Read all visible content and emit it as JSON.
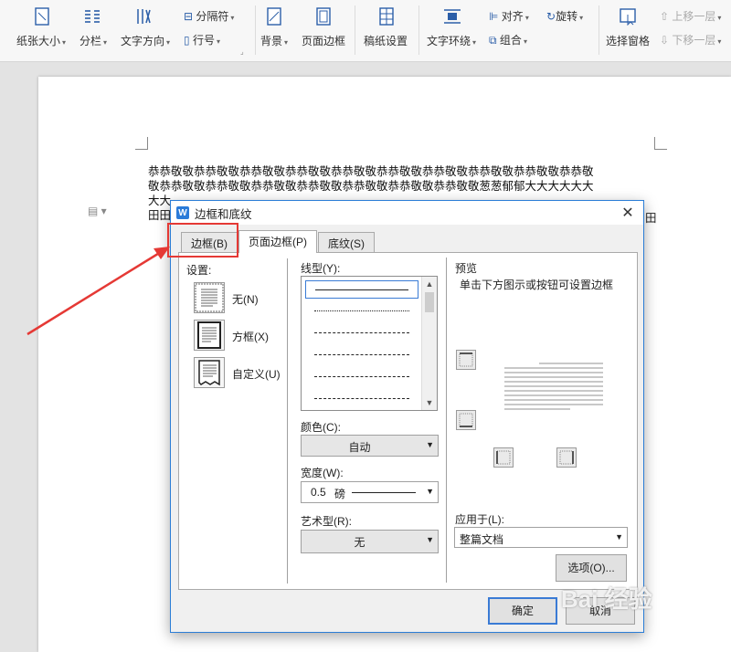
{
  "ribbon": {
    "paper_size": "纸张大小",
    "columns": "分栏",
    "text_direction": "文字方向",
    "separator": "分隔符",
    "line_number": "行号",
    "background": "背景",
    "page_border": "页面边框",
    "manuscript": "稿纸设置",
    "text_wrap": "文字环绕",
    "align": "对齐",
    "rotate": "旋转",
    "group": "组合",
    "selection_pane": "选择窗格",
    "bring_forward": "上移一层",
    "send_backward": "下移一层"
  },
  "document": {
    "lines": [
      "恭恭敬敬恭恭敬敬恭恭敬敬恭恭敬敬恭恭敬敬恭恭敬敬恭恭敬敬恭恭敬敬恭恭敬敬恭恭敬",
      "敬恭恭敬敬恭恭敬敬恭恭敬敬恭恭敬敬恭恭敬敬恭恭敬敬恭恭敬敬葱葱郁郁大大大大大大",
      "大大",
      "田田"
    ],
    "right_line3": "田"
  },
  "dialog": {
    "title": "边框和底纹",
    "logo": "W",
    "tabs": [
      "边框(B)",
      "页面边框(P)",
      "底纹(S)"
    ],
    "settings_label": "设置:",
    "settings": [
      "无(N)",
      "方框(X)",
      "自定义(U)"
    ],
    "line_style_label": "线型(Y):",
    "color_label": "颜色(C):",
    "color_value": "自动",
    "width_label": "宽度(W):",
    "width_value": "0.5",
    "width_unit": "磅",
    "art_label": "艺术型(R):",
    "art_value": "无",
    "preview_label": "预览",
    "preview_hint": "单击下方图示或按钮可设置边框",
    "apply_label": "应用于(L):",
    "apply_value": "整篇文档",
    "options_button": "选项(O)...",
    "ok_button": "确定",
    "cancel_button": "取消"
  },
  "watermark": "Bai 经验"
}
